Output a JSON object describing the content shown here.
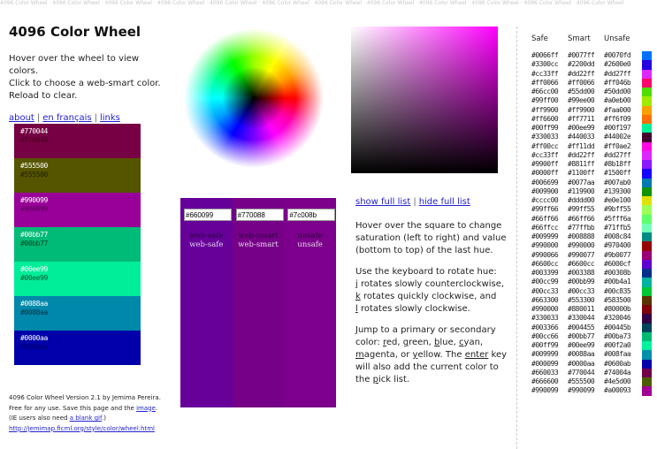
{
  "banner": "4096 Color Wheel · 4096 Color Wheel · 4096 Color Wheel · 4096 Color Wheel · 4096 Color Wheel · 4096 Color Wheel · 4096 Color Wheel · 4096 Color Wheel · 4096 Color Wheel · 4096 Color Wheel · 4096 Color Wheel · 4096 Color Wheel",
  "title": "4096 Color Wheel",
  "intro": {
    "line1": "Hover over the wheel to view colors.",
    "line2": "Click to choose a web-smart color.",
    "line3": "Reload to clear."
  },
  "nav": {
    "about": "about",
    "french": "en français",
    "links": "links",
    "separator": "|"
  },
  "picklist": [
    {
      "hex": "#770044",
      "color": "#770044",
      "text2": "#440022"
    },
    {
      "hex": "#555500",
      "color": "#555500",
      "text2": "#222200"
    },
    {
      "hex": "#990099",
      "color": "#990099",
      "text2": "#550055"
    },
    {
      "hex": "#00bb77",
      "color": "#00bb77",
      "text2": "#004422"
    },
    {
      "hex": "#00ee99",
      "color": "#00ee99",
      "text2": "#005533"
    },
    {
      "hex": "#0088aa",
      "color": "#0088aa",
      "text2": "#003344"
    },
    {
      "hex": "#0000aa",
      "color": "#0000aa",
      "text2": "#000066"
    }
  ],
  "footer": {
    "line1": "4096 Color Wheel Version 2.1 by Jemima Pereira.",
    "line2_pre": "Free for any use. Save this page and the ",
    "image_link": "image",
    "line2_post": ".",
    "line3_pre": "(IE users also need ",
    "gif_link": "a blank gif",
    "line3_post": ".)",
    "url": "http://jemimap.ficml.org/style/color/wheel.html"
  },
  "compare": [
    {
      "value": "#660099",
      "color": "#660099",
      "label": "web-safe"
    },
    {
      "value": "#770088",
      "color": "#770088",
      "label": "web-smart"
    },
    {
      "value": "#7c008b",
      "color": "#7c008b",
      "label": "unsafe"
    }
  ],
  "square_hue": "#ff00ff",
  "list_links": {
    "show": "show full list",
    "hide": "hide full list",
    "separator": "|"
  },
  "help": {
    "p1": "Hover over the square to change saturation (left to right) and value (bottom to top) of the last hue.",
    "p2_intro": "Use the keyboard to rotate hue:",
    "p2_j_key": "j",
    "p2_j": " rotates slowly counterclockwise,",
    "p2_k_key": "k",
    "p2_k": " rotates quickly clockwise, and",
    "p2_l_key": "l",
    "p2_l": " rotates slowly clockwise.",
    "p3_a": "Jump to a primary or secondary color: ",
    "r_key": "r",
    "r_rest": "ed",
    "g_key": "g",
    "g_rest": "reen",
    "b_key": "b",
    "b_rest": "lue",
    "c_key": "c",
    "c_rest": "yan",
    "m_key": "m",
    "m_rest": "agenta",
    "or": ", or ",
    "y_key": "y",
    "y_rest": "ellow",
    "p3_b": ". The ",
    "enter_key": "enter",
    "p3_c": " key will also add the current color to the ",
    "p_key": "p",
    "p_rest": "ick list."
  },
  "table": {
    "headers": [
      "Safe",
      "Smart",
      "Unsafe"
    ],
    "rows": [
      [
        "#0066ff",
        "#0077ff",
        "#0070fd"
      ],
      [
        "#3300cc",
        "#2200dd",
        "#2600e0"
      ],
      [
        "#cc33ff",
        "#dd22ff",
        "#dd27ff"
      ],
      [
        "#ff0066",
        "#ff0066",
        "#ff046b"
      ],
      [
        "#66cc00",
        "#55dd00",
        "#50dd00"
      ],
      [
        "#99ff00",
        "#99ee00",
        "#a0eb00"
      ],
      [
        "#ff9900",
        "#ff9900",
        "#faa000"
      ],
      [
        "#ff6600",
        "#ff7711",
        "#ff6f09"
      ],
      [
        "#00ff99",
        "#00ee99",
        "#00f197"
      ],
      [
        "#330033",
        "#440033",
        "#44002e"
      ],
      [
        "#ff00cc",
        "#ff11dd",
        "#ff0ae2"
      ],
      [
        "#cc33ff",
        "#dd22ff",
        "#dd27ff"
      ],
      [
        "#9900ff",
        "#8811ff",
        "#8b18ff"
      ],
      [
        "#0000ff",
        "#1100ff",
        "#1500ff"
      ],
      [
        "#006699",
        "#0077aa",
        "#007ab0"
      ],
      [
        "#009900",
        "#119900",
        "#139300"
      ],
      [
        "#cccc00",
        "#dddd00",
        "#e0e100"
      ],
      [
        "#99ff66",
        "#99ff55",
        "#9bff55"
      ],
      [
        "#66ff66",
        "#66ff66",
        "#5fff6a"
      ],
      [
        "#66ffcc",
        "#77ffbb",
        "#71ffb5"
      ],
      [
        "#009999",
        "#008888",
        "#008c84"
      ],
      [
        "#990000",
        "#990000",
        "#970400"
      ],
      [
        "#990066",
        "#990077",
        "#9b0077"
      ],
      [
        "#6600cc",
        "#6600cc",
        "#6000cf"
      ],
      [
        "#003399",
        "#003388",
        "#00308b"
      ],
      [
        "#00cc99",
        "#00bb99",
        "#00b4a1"
      ],
      [
        "#00cc33",
        "#00cc33",
        "#00c835"
      ],
      [
        "#663300",
        "#553300",
        "#583500"
      ],
      [
        "#990000",
        "#880011",
        "#80000b"
      ],
      [
        "#330033",
        "#330044",
        "#320046"
      ],
      [
        "#003366",
        "#004455",
        "#00445b"
      ],
      [
        "#00cc66",
        "#00bb77",
        "#00ba73"
      ],
      [
        "#00ff99",
        "#00ee99",
        "#00f2a0"
      ],
      [
        "#009999",
        "#0088aa",
        "#008faa"
      ],
      [
        "#000099",
        "#0000aa",
        "#0600ab"
      ],
      [
        "#660033",
        "#770044",
        "#74004a"
      ],
      [
        "#666600",
        "#555500",
        "#4e5d00"
      ],
      [
        "#990099",
        "#990099",
        "#a00093"
      ]
    ]
  }
}
